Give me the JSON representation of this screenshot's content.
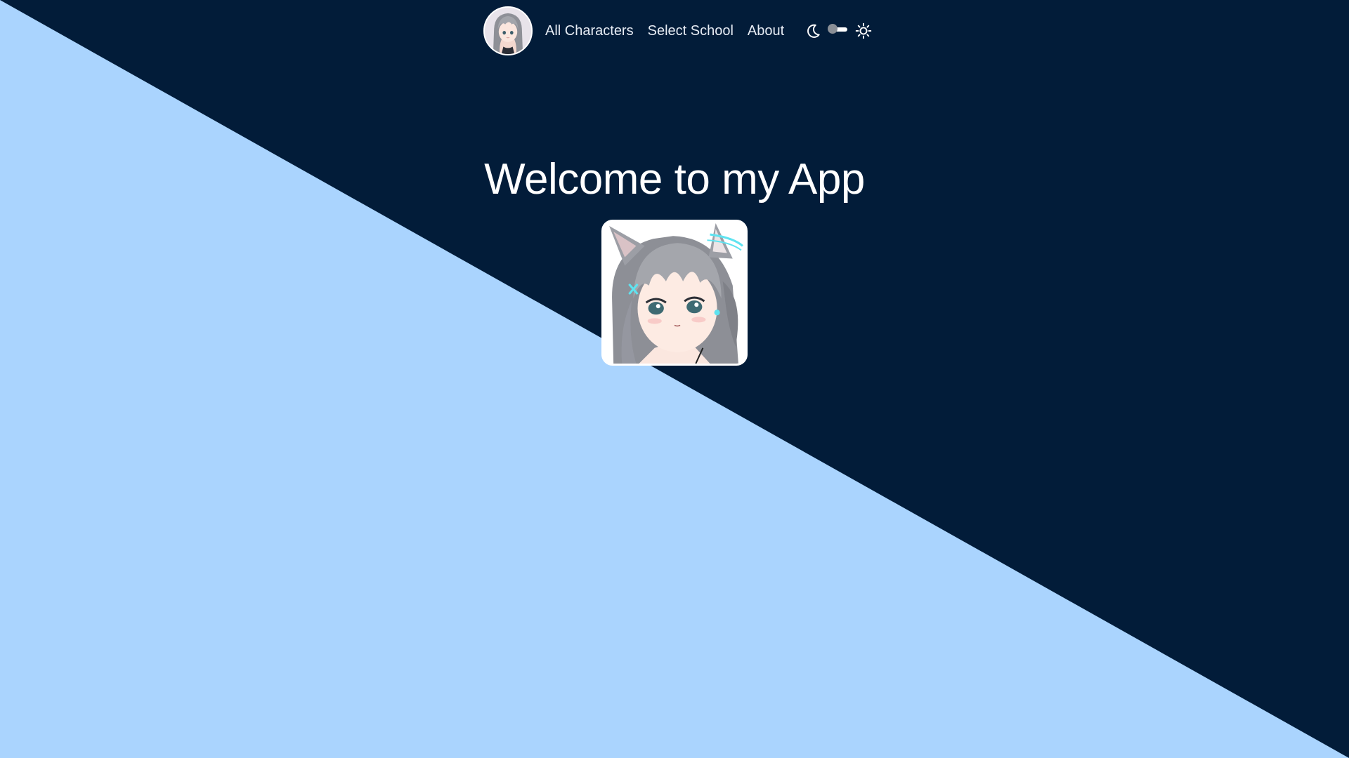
{
  "nav": {
    "avatar_icon": "character-avatar-icon",
    "links": [
      {
        "label": "All Characters"
      },
      {
        "label": "Select School"
      },
      {
        "label": "About"
      }
    ],
    "theme_toggle": {
      "dark_icon": "moon-icon",
      "light_icon": "sun-icon",
      "state": "dark"
    }
  },
  "hero": {
    "title": "Welcome to my App",
    "image_icon": "character-portrait-icon"
  },
  "colors": {
    "dark_background": "#021c39",
    "light_background": "#aad4fe",
    "text": "#ffffff"
  }
}
